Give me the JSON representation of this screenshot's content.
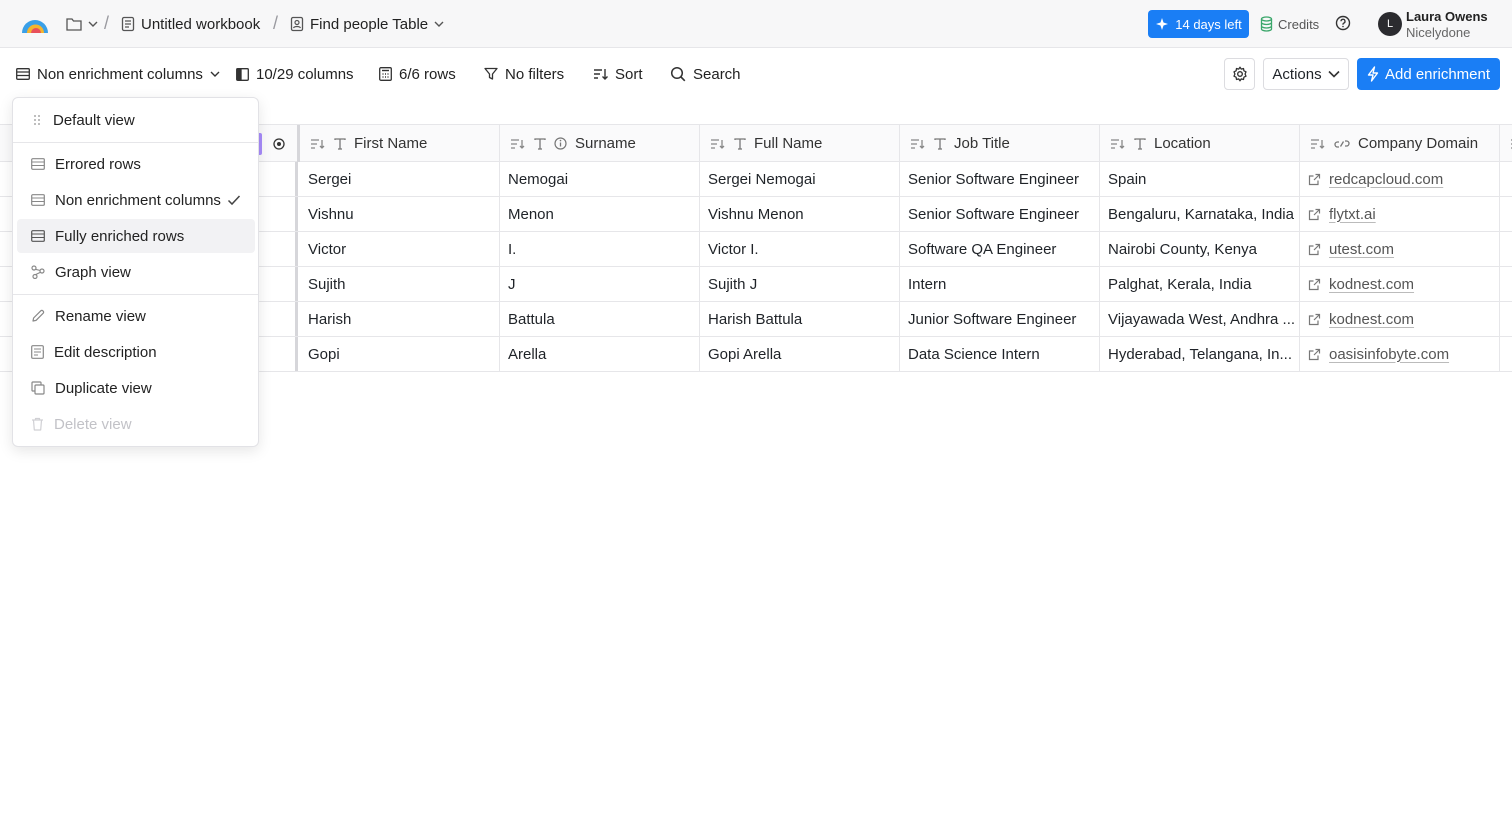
{
  "topbar": {
    "workbook": "Untitled workbook",
    "table": "Find people Table",
    "trial": "14 days left",
    "credits": "Credits",
    "user_name": "Laura Owens",
    "user_org": "Nicelydone",
    "avatar_initial": "L"
  },
  "toolbar": {
    "view": "Non enrichment columns",
    "columns": "10/29 columns",
    "rows": "6/6 rows",
    "filters": "No filters",
    "sort": "Sort",
    "search": "Search",
    "actions": "Actions",
    "add": "Add enrichment"
  },
  "columns": [
    "First Name",
    "Surname",
    "Full Name",
    "Job Title",
    "Location",
    "Company Domain"
  ],
  "rows": [
    {
      "first": "Sergei",
      "surname": "Nemogai",
      "full": "Sergei Nemogai",
      "title": "Senior Software Engineer",
      "location": "Spain",
      "domain": "redcapcloud.com"
    },
    {
      "first": "Vishnu",
      "surname": "Menon",
      "full": "Vishnu Menon",
      "title": "Senior Software Engineer",
      "location": "Bengaluru, Karnataka, India",
      "domain": "flytxt.ai"
    },
    {
      "first": "Victor",
      "surname": "I.",
      "full": "Victor I.",
      "title": "Software QA Engineer",
      "location": "Nairobi County, Kenya",
      "domain": "utest.com"
    },
    {
      "first": "Sujith",
      "surname": "J",
      "full": "Sujith J",
      "title": "Intern",
      "location": "Palghat, Kerala, India",
      "domain": "kodnest.com"
    },
    {
      "first": "Harish",
      "surname": "Battula",
      "full": "Harish Battula",
      "title": "Junior Software Engineer",
      "location": "Vijayawada West, Andhra ...",
      "domain": "kodnest.com"
    },
    {
      "first": "Gopi",
      "surname": "Arella",
      "full": "Gopi Arella",
      "title": "Data Science Intern",
      "location": "Hyderabad, Telangana, In...",
      "domain": "oasisinfobyte.com"
    }
  ],
  "menu": {
    "default": "Default view",
    "errored": "Errored rows",
    "non_enrichment": "Non enrichment columns",
    "fully_enriched": "Fully enriched rows",
    "graph": "Graph view",
    "rename": "Rename view",
    "edit_desc": "Edit description",
    "duplicate": "Duplicate view",
    "delete": "Delete view"
  },
  "colors": {
    "accent": "#1a7ef5",
    "highlight": "#f2f2f4"
  }
}
